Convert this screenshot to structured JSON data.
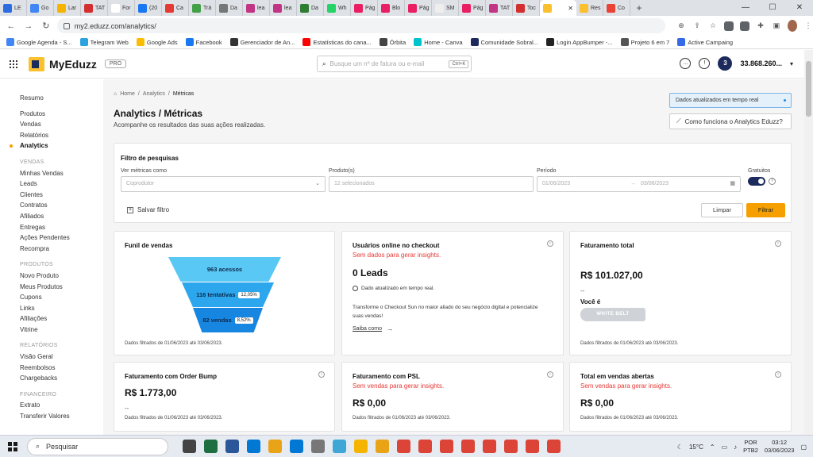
{
  "browser": {
    "tabs": [
      {
        "label": "LE",
        "color": "#2d6cdf"
      },
      {
        "label": "Go",
        "color": "#4285f4"
      },
      {
        "label": "Lar",
        "color": "#f5b400"
      },
      {
        "label": "TAT",
        "color": "#d32f2f"
      },
      {
        "label": "For",
        "color": "#ffffff"
      },
      {
        "label": "(20",
        "color": "#1877f2"
      },
      {
        "label": "Ca",
        "color": "#e53935"
      },
      {
        "label": "Trá",
        "color": "#43a047"
      },
      {
        "label": "Da",
        "color": "#777777"
      },
      {
        "label": "lea",
        "color": "#c13584"
      },
      {
        "label": "lea",
        "color": "#c13584"
      },
      {
        "label": "Da",
        "color": "#2e7d32"
      },
      {
        "label": "Wh",
        "color": "#25d366"
      },
      {
        "label": "Pág",
        "color": "#e91e63"
      },
      {
        "label": "Blo",
        "color": "#e91e63"
      },
      {
        "label": "Pág",
        "color": "#e91e63"
      },
      {
        "label": "SM",
        "color": "#eeeeee"
      },
      {
        "label": "Pág",
        "color": "#e91e63"
      },
      {
        "label": "TAT",
        "color": "#c13584"
      },
      {
        "label": "Toc",
        "color": "#d32f2f"
      },
      {
        "label": "Res",
        "color": "#fbc02d"
      },
      {
        "label": "Co",
        "color": "#ea4335"
      }
    ],
    "active_tab": {
      "label": "",
      "color": "#fbc02d"
    },
    "new_tab": "+",
    "url": "my2.eduzz.com/analytics/",
    "bookmarks": [
      {
        "label": "Google Agenda - S...",
        "color": "#4285f4"
      },
      {
        "label": "Telegram Web",
        "color": "#2aa3df"
      },
      {
        "label": "Google Ads",
        "color": "#fbbc04"
      },
      {
        "label": "Facebook",
        "color": "#1877f2"
      },
      {
        "label": "Gerenciador de An...",
        "color": "#333333"
      },
      {
        "label": "Estatísticas do cana...",
        "color": "#ff0000"
      },
      {
        "label": "Órbita",
        "color": "#444444"
      },
      {
        "label": "Home - Canva",
        "color": "#00c4cc"
      },
      {
        "label": "Comunidade Sobral...",
        "color": "#1d2b5c"
      },
      {
        "label": "Login AppBumper -...",
        "color": "#222222"
      },
      {
        "label": "Projeto 6 em 7",
        "color": "#555555"
      },
      {
        "label": "Active Campaing",
        "color": "#356ae6"
      }
    ]
  },
  "app": {
    "brand": "MyEduzz",
    "plan": "PRO",
    "search_placeholder": "Busque um nº de fatura ou e-mail",
    "search_shortcut": "Ctrl+K",
    "account_badge": "3",
    "account_value": "33.868.260..."
  },
  "sidebar": {
    "top": [
      "Resumo",
      "Produtos",
      "Vendas",
      "Relatórios",
      "Analytics"
    ],
    "sections": [
      {
        "title": "VENDAS",
        "items": [
          "Minhas Vendas",
          "Leads",
          "Clientes",
          "Contratos",
          "Afiliados",
          "Entregas",
          "Ações Pendentes",
          "Recompra"
        ]
      },
      {
        "title": "PRODUTOS",
        "items": [
          "Novo Produto",
          "Meus Produtos",
          "Cupons",
          "Links",
          "Afiliações",
          "Vitrine"
        ]
      },
      {
        "title": "RELATÓRIOS",
        "items": [
          "Visão Geral",
          "Reembolsos",
          "Chargebacks"
        ]
      },
      {
        "title": "FINANCEIRO",
        "items": [
          "Extrato",
          "Transferir Valores"
        ]
      }
    ]
  },
  "page": {
    "breadcrumb": [
      "Home",
      "/",
      "Analytics",
      "/",
      "Métricas"
    ],
    "title": "Analytics / Métricas",
    "subtitle": "Acompanhe os resultados das suas ações realizadas.",
    "realtime_badge": "Dados atualizados em tempo real",
    "how_button": "Como funciona o Analytics Eduzz?"
  },
  "filter": {
    "title": "Filtro de pesquisas",
    "metrics_label": "Ver métricas como",
    "metrics_value": "Coprodutor",
    "product_label": "Produto(s)",
    "product_value": "12 selecionados",
    "period_label": "Período",
    "period_from": "01/06/2023",
    "period_to": "03/06/2023",
    "free_label": "Gratuitos",
    "save_label": "Salvar filtro",
    "clear_label": "Limpar",
    "filter_label": "Filtrar"
  },
  "cards": {
    "funnel": {
      "title": "Funil de vendas",
      "stages": [
        {
          "label": "963 acessos",
          "pct": "",
          "color": "#5ac8f5"
        },
        {
          "label": "116 tentativas",
          "pct": "12,05%",
          "color": "#2ca6ec"
        },
        {
          "label": "82 vendas",
          "pct": "8,52%",
          "color": "#1786e0"
        }
      ],
      "footer": "Dados filtrados de 01/06/2023 até 03/06/2023."
    },
    "online": {
      "title": "Usuários online no checkout",
      "warning": "Sem dados para gerar insights.",
      "value": "0 Leads",
      "realtime": "Dado atualizado em tempo real.",
      "promo": "Transforme o Checkout Sun no maior aliado do seu negócio digital e potencialize suas vendas!",
      "link": "Saiba como",
      "link_arrow": "→"
    },
    "revenue": {
      "title": "Faturamento total",
      "value": "R$ 101.027,00",
      "dash": "--",
      "you_are": "Você é",
      "belt": "WHITE BELT",
      "footer": "Dados filtrados de 01/06/2023 até 03/06/2023."
    },
    "bump": {
      "title": "Faturamento com Order Bump",
      "value": "R$ 1.773,00",
      "dash": "--",
      "footer": "Dados filtrados de 01/06/2023 até 03/06/2023."
    },
    "psl": {
      "title": "Faturamento com PSL",
      "warning": "Sem vendas para gerar insights.",
      "value": "R$ 0,00",
      "footer": "Dados filtrados de 01/06/2023 até 03/06/2023."
    },
    "open_sales": {
      "title": "Total em vendas abertas",
      "warning": "Sem vendas para gerar insights.",
      "value": "R$ 0,00",
      "footer": "Dados filtrados de 01/06/2023 até 03/06/2023."
    }
  },
  "taskbar": {
    "search_label": "Pesquisar",
    "apps": [
      "#444444",
      "#1d6f42",
      "#2b579a",
      "#0078d4",
      "#e8a317",
      "#0078d4",
      "#777777",
      "#3fa7d6",
      "#f4b400",
      "#e8a317",
      "#db4437",
      "#db4437",
      "#db4437",
      "#db4437",
      "#db4437",
      "#db4437",
      "#db4437",
      "#db4437"
    ],
    "weather": "15°C",
    "lang": "POR",
    "lang2": "PTB2",
    "time": "03:12",
    "date": "03/06/2023"
  }
}
